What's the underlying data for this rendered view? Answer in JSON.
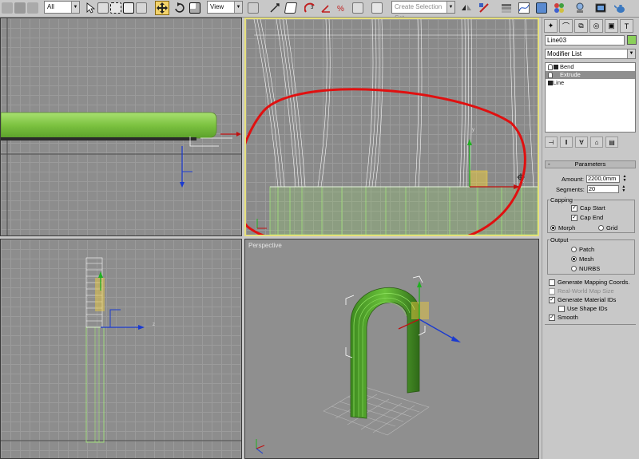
{
  "toolbar": {
    "selection_filter": "All",
    "ref_coord": "View",
    "named_selection": "Create Selection Set",
    "icons": [
      "select-icon",
      "select-region-icon",
      "window-crossing-icon",
      "move-icon",
      "rotate-icon",
      "scale-icon",
      "snap-icon",
      "angle-snap-icon",
      "percent-snap-icon",
      "mirror-icon",
      "align-icon",
      "layer-icon",
      "curve-editor-icon",
      "schematic-icon",
      "material-editor-icon",
      "render-setup-icon",
      "render-icon",
      "teapot-render-icon"
    ]
  },
  "viewports": {
    "perspective_label": "Perspective"
  },
  "colors": {
    "object": "#8bd05a",
    "highlight": "#e6e07a",
    "annotation": "#e01010"
  },
  "panel": {
    "object_name": "Line03",
    "modifier_list": "Modifier List",
    "stack": [
      {
        "label": "Bend",
        "selected": false
      },
      {
        "label": "Extrude",
        "selected": true
      },
      {
        "label": "Line",
        "selected": false
      }
    ],
    "rollout_title": "Parameters",
    "amount_label": "Amount:",
    "amount_value": "2200,0mm",
    "segments_label": "Segments:",
    "segments_value": "20",
    "capping_label": "Capping",
    "cap_start": "Cap Start",
    "cap_end": "Cap End",
    "morph": "Morph",
    "grid": "Grid",
    "output_label": "Output",
    "patch": "Patch",
    "mesh": "Mesh",
    "nurbs": "NURBS",
    "gen_mapping": "Generate Mapping Coords.",
    "real_world": "Real-World Map Size",
    "gen_material": "Generate Material IDs",
    "use_shape": "Use Shape IDs",
    "smooth": "Smooth"
  }
}
